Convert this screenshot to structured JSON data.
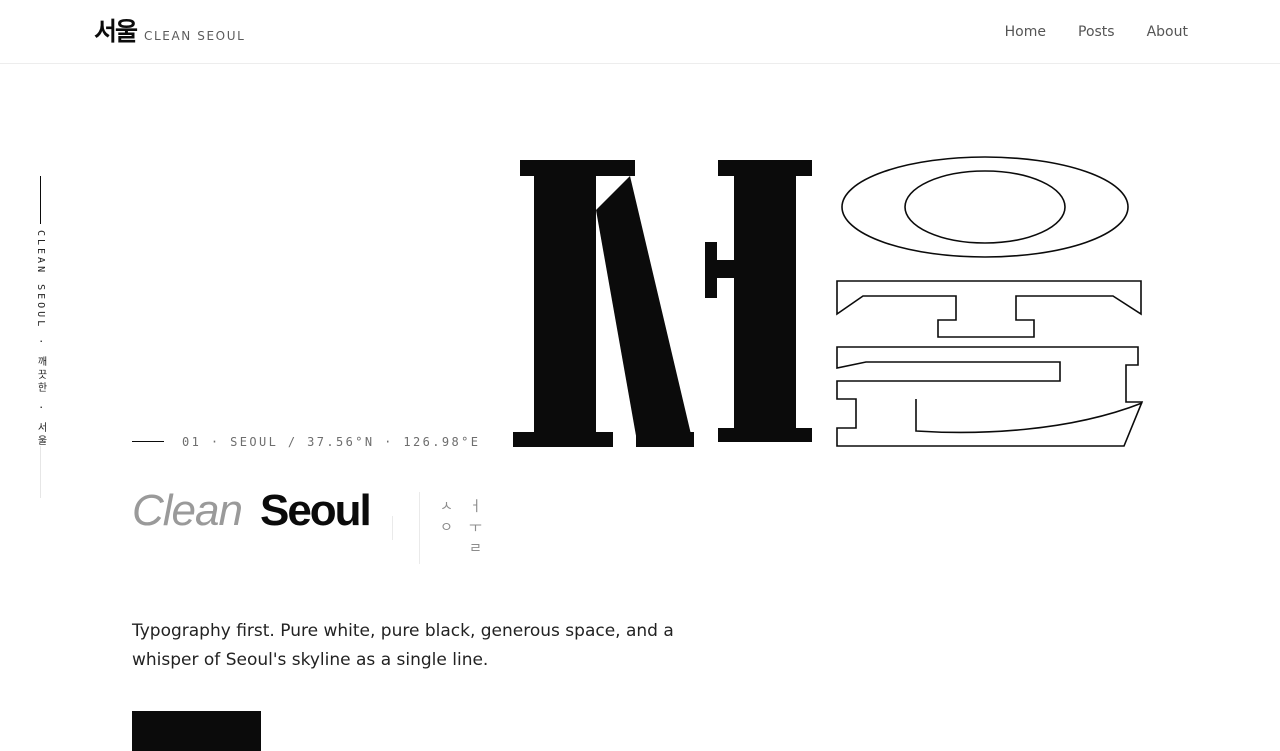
{
  "header": {
    "brand_mark": "서울",
    "brand_name": "CLEAN SEOUL",
    "nav": [
      "Home",
      "Posts",
      "About"
    ]
  },
  "side_tag": "CLEAN SEOUL · 깨끗한 · 서울",
  "hero": {
    "meta": "01 · SEOUL  /  37.56°N · 126.98°E",
    "title_light": "Clean",
    "title_bold": "Seoul",
    "jamo": [
      "ㅅ",
      "ㅓ",
      "ㅇ",
      "ㅜ",
      "ㄹ"
    ],
    "description": "Typography first. Pure white, pure black, generous space, and a whisper of Seoul's skyline as a single line."
  },
  "colors": {
    "ink": "#0b0b0b",
    "paper": "#ffffff",
    "muted": "#9a9a9a"
  }
}
